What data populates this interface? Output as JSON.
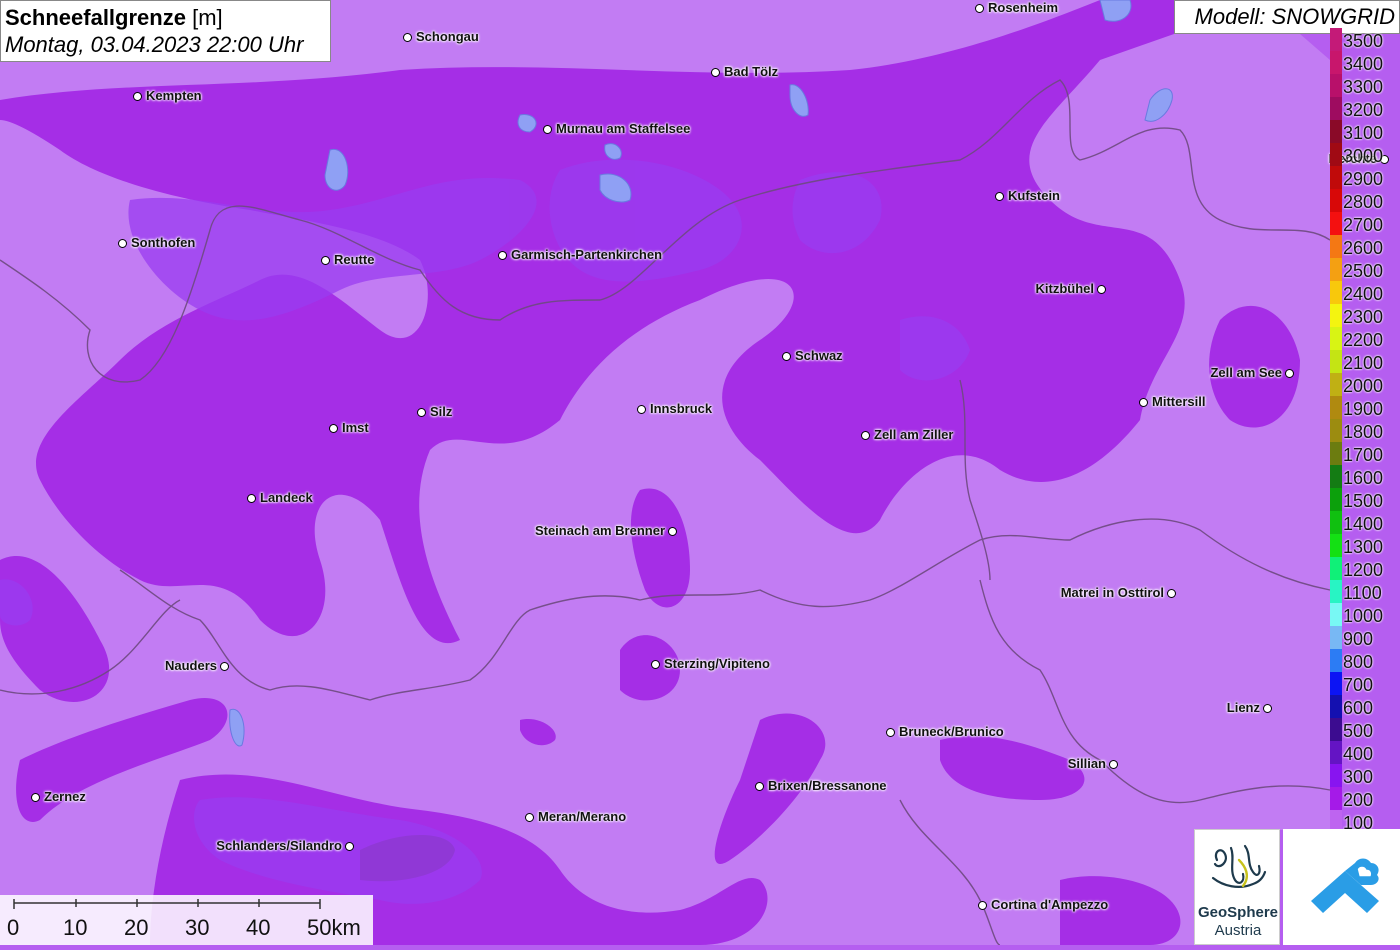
{
  "header": {
    "title": "Schneefallgrenze",
    "unit": "[m]",
    "datetime": "Montag, 03.04.2023 22:00 Uhr",
    "model": "Modell: SNOWGRID"
  },
  "cities": [
    {
      "name": "Rosenheim"
    },
    {
      "name": "Schongau"
    },
    {
      "name": "Bad Tölz"
    },
    {
      "name": "Kempten"
    },
    {
      "name": "Murnau am Staffelsee"
    },
    {
      "name": "Berchte"
    },
    {
      "name": "Kufstein"
    },
    {
      "name": "Sonthofen"
    },
    {
      "name": "Reutte"
    },
    {
      "name": "Garmisch-Partenkirchen"
    },
    {
      "name": "Kitzbühel"
    },
    {
      "name": "Schwaz"
    },
    {
      "name": "Zell am See"
    },
    {
      "name": "Mittersill"
    },
    {
      "name": "Innsbruck"
    },
    {
      "name": "Silz"
    },
    {
      "name": "Imst"
    },
    {
      "name": "Zell am Ziller"
    },
    {
      "name": "Landeck"
    },
    {
      "name": "Steinach am Brenner"
    },
    {
      "name": "Matrei in Osttirol"
    },
    {
      "name": "Nauders"
    },
    {
      "name": "Sterzing/Vipiteno"
    },
    {
      "name": "Lienz"
    },
    {
      "name": "Bruneck/Brunico"
    },
    {
      "name": "Sillian"
    },
    {
      "name": "Zernez"
    },
    {
      "name": "Brixen/Bressanone"
    },
    {
      "name": "Meran/Merano"
    },
    {
      "name": "Schlanders/Silandro"
    },
    {
      "name": "Cortina d'Ampezzo"
    }
  ],
  "legend": {
    "items": [
      {
        "label": "3500",
        "color": "#c41a78"
      },
      {
        "label": "3400",
        "color": "#c8166c"
      },
      {
        "label": "3300",
        "color": "#b8106a"
      },
      {
        "label": "3200",
        "color": "#9e0c60"
      },
      {
        "label": "3100",
        "color": "#8a0a28"
      },
      {
        "label": "3000",
        "color": "#a00a14"
      },
      {
        "label": "2900",
        "color": "#c00a0a"
      },
      {
        "label": "2800",
        "color": "#d80808"
      },
      {
        "label": "2700",
        "color": "#f41010"
      },
      {
        "label": "2600",
        "color": "#f47814"
      },
      {
        "label": "2500",
        "color": "#f4a012"
      },
      {
        "label": "2400",
        "color": "#f8c80c"
      },
      {
        "label": "2300",
        "color": "#f4f410"
      },
      {
        "label": "2200",
        "color": "#d8f414"
      },
      {
        "label": "2100",
        "color": "#c4e414"
      },
      {
        "label": "2000",
        "color": "#c0b014"
      },
      {
        "label": "1900",
        "color": "#b08a10"
      },
      {
        "label": "1800",
        "color": "#9c8c10"
      },
      {
        "label": "1700",
        "color": "#6c7c10"
      },
      {
        "label": "1600",
        "color": "#147c14"
      },
      {
        "label": "1500",
        "color": "#0ca00c"
      },
      {
        "label": "1400",
        "color": "#10c010"
      },
      {
        "label": "1300",
        "color": "#14e014"
      },
      {
        "label": "1200",
        "color": "#10f078"
      },
      {
        "label": "1100",
        "color": "#28f4c4"
      },
      {
        "label": "1000",
        "color": "#78f8f4"
      },
      {
        "label": "900",
        "color": "#78b8f4"
      },
      {
        "label": "800",
        "color": "#2c7cf4"
      },
      {
        "label": "700",
        "color": "#0c14f4"
      },
      {
        "label": "600",
        "color": "#1410b0"
      },
      {
        "label": "500",
        "color": "#3c0c90"
      },
      {
        "label": "400",
        "color": "#6414c4"
      },
      {
        "label": "300",
        "color": "#8814f0"
      },
      {
        "label": "200",
        "color": "#a51ae8"
      },
      {
        "label": "100",
        "color": "#be64f0"
      }
    ]
  },
  "scale": {
    "ticks": [
      "0",
      "10",
      "20",
      "30",
      "40",
      "50km"
    ]
  },
  "logos": {
    "geosphere_line1": "GeoSphere",
    "geosphere_line2": "Austria"
  }
}
